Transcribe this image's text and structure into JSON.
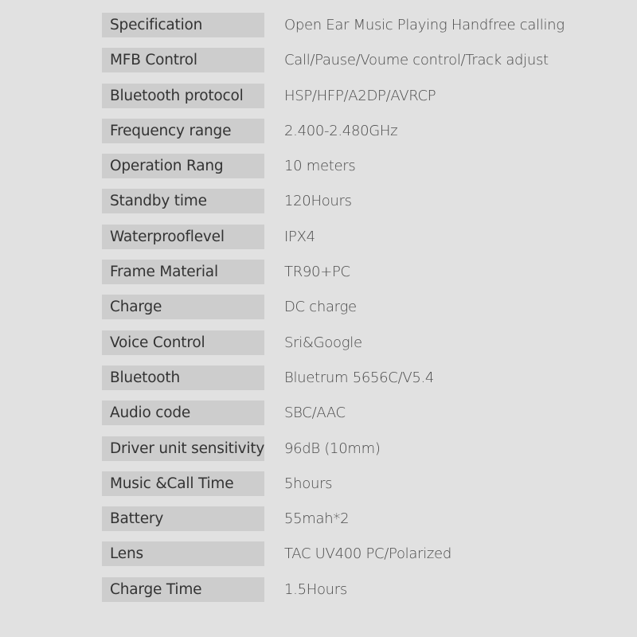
{
  "colors": {
    "background": "#e1e1e1",
    "label_background": "#cdcdcd",
    "label_text": "#333333",
    "value_text": "#4a4a4a"
  },
  "specs": [
    {
      "label": "Specification",
      "value": "Open Ear Music Playing Handfree calling"
    },
    {
      "label": "MFB Control",
      "value": "Call/Pause/Voume control/Track adjust"
    },
    {
      "label": "Bluetooth protocol",
      "value": "HSP/HFP/A2DP/AVRCP"
    },
    {
      "label": "Frequency range",
      "value": "2.400-2.480GHz"
    },
    {
      "label": "Operation Rang",
      "value": "10 meters"
    },
    {
      "label": "Standby time",
      "value": "120Hours"
    },
    {
      "label": "Waterprooflevel",
      "value": "IPX4"
    },
    {
      "label": "Frame Material",
      "value": "TR90+PC"
    },
    {
      "label": "Charge",
      "value": "DC charge"
    },
    {
      "label": "Voice Control",
      "value": "Sri&Google"
    },
    {
      "label": "Bluetooth",
      "value": "Bluetrum 5656C/V5.4"
    },
    {
      "label": "Audio code",
      "value": "SBC/AAC"
    },
    {
      "label": "Driver unit sensitivity",
      "value": "96dB (10mm)"
    },
    {
      "label": "Music &Call Time",
      "value": "5hours"
    },
    {
      "label": "Battery",
      "value": "55mah*2"
    },
    {
      "label": "Lens",
      "value": "TAC UV400 PC/Polarized"
    },
    {
      "label": "Charge Time",
      "value": "1.5Hours"
    }
  ]
}
